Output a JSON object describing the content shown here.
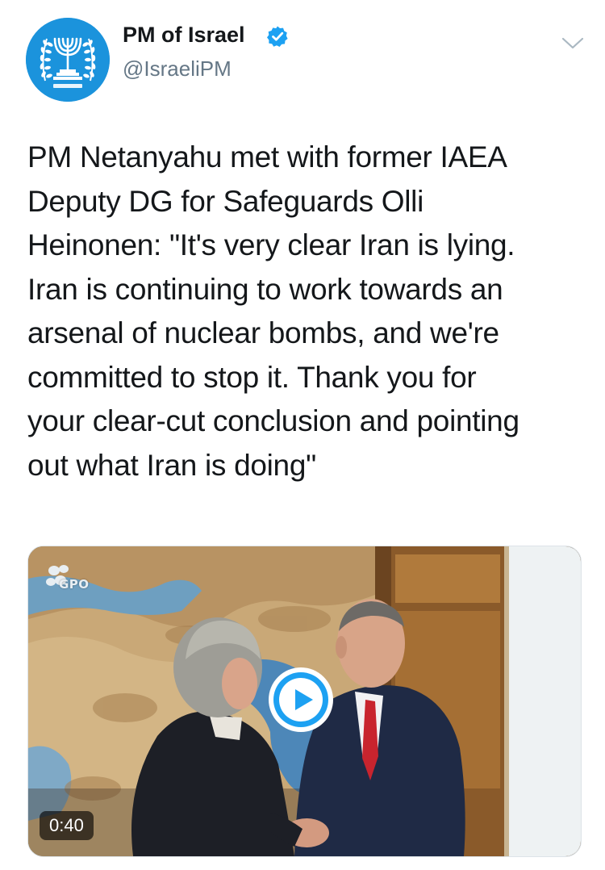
{
  "author": {
    "display_name": "PM of Israel",
    "handle": "@IsraeliPM",
    "verified": true,
    "avatar_icon": "menorah-emblem-icon",
    "avatar_color": "#1b93dc"
  },
  "tweet": {
    "text_lines": [
      "PM Netanyahu met with former IAEA",
      "Deputy DG for Safeguards Olli",
      "Heinonen: \"It's very clear Iran is lying.",
      "Iran is continuing to work towards an",
      "arsenal of nuclear bombs, and we're",
      "committed to stop it. Thank you for",
      "your clear-cut conclusion and pointing",
      "out what Iran is doing\""
    ]
  },
  "media": {
    "type": "video",
    "duration": "0:40",
    "watermark": "GPO",
    "play_icon": "play-icon",
    "accent_color": "#1da1f2"
  },
  "icons": {
    "verified": "verified-badge-icon",
    "menu": "chevron-down-icon"
  }
}
